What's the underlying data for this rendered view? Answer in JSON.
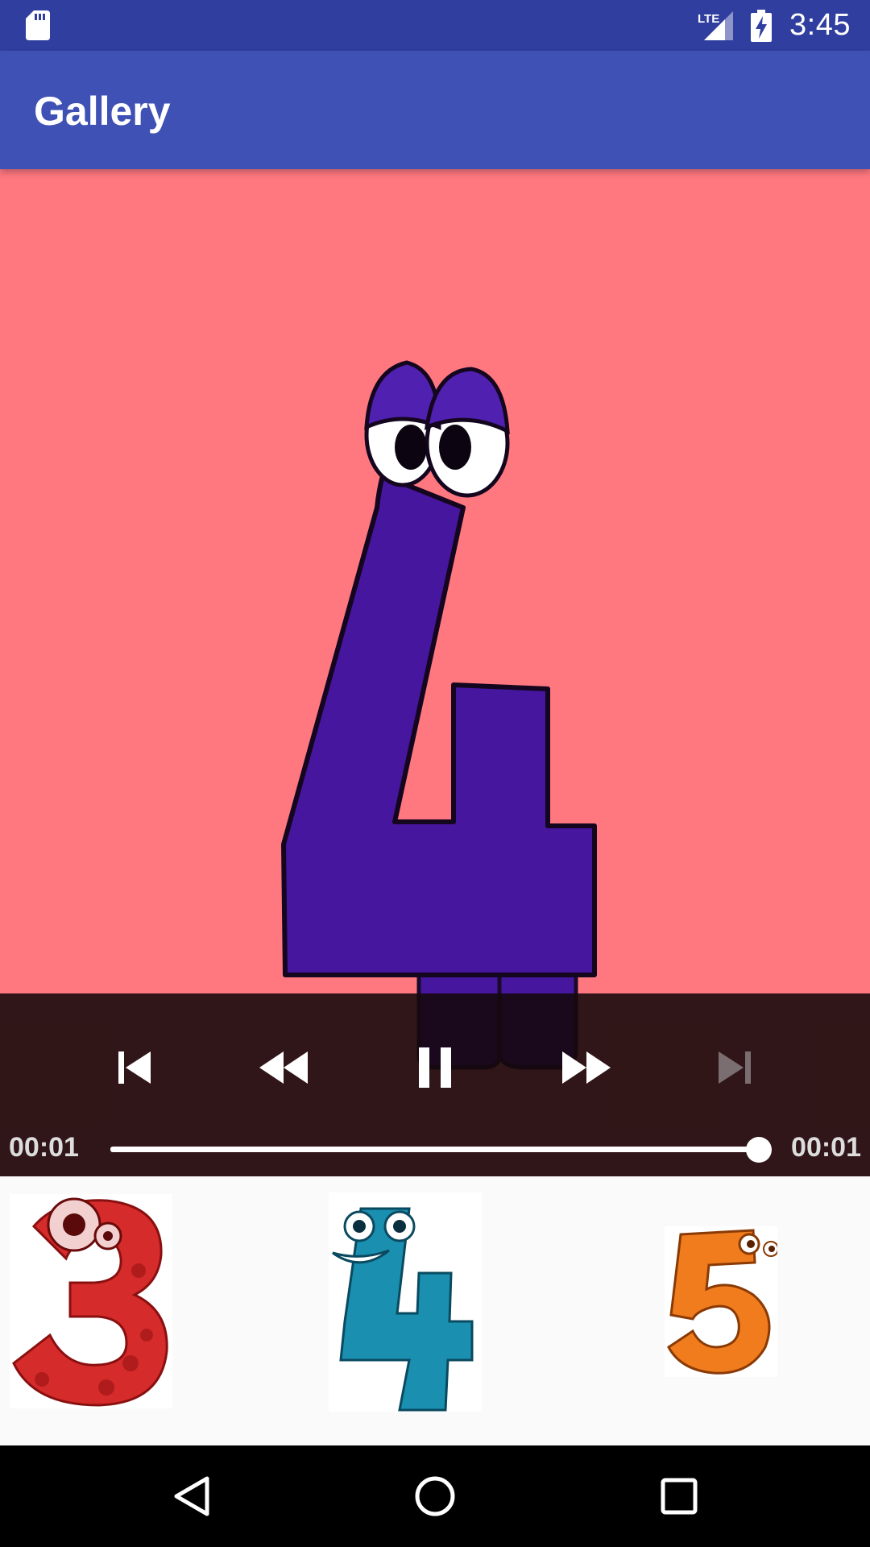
{
  "status_bar": {
    "network_label": "LTE",
    "time": "3:45",
    "icons": [
      "sd-card-icon",
      "lte-signal-icon",
      "battery-charging-icon"
    ]
  },
  "app_bar": {
    "title": "Gallery"
  },
  "video": {
    "subject": "number-four-character",
    "background_color": "#ff7880"
  },
  "controller": {
    "buttons": [
      "previous-icon",
      "rewind-icon",
      "pause-icon",
      "fast-forward-icon",
      "next-icon"
    ],
    "next_enabled": false,
    "elapsed": "00:01",
    "duration": "00:01",
    "progress": 1.0
  },
  "thumbnails": [
    {
      "subject": "number-three-character",
      "color": "#d62b2b"
    },
    {
      "subject": "number-four-character",
      "color": "#1a8fb0"
    },
    {
      "subject": "number-five-character",
      "color": "#f07c1e"
    }
  ],
  "nav_bar": {
    "buttons": [
      "back-icon",
      "home-icon",
      "recents-icon"
    ]
  },
  "colors": {
    "status_bar": "#303f9f",
    "app_bar": "#3f51b5",
    "video_bg": "#ff7880",
    "character_purple": "#46169e"
  }
}
